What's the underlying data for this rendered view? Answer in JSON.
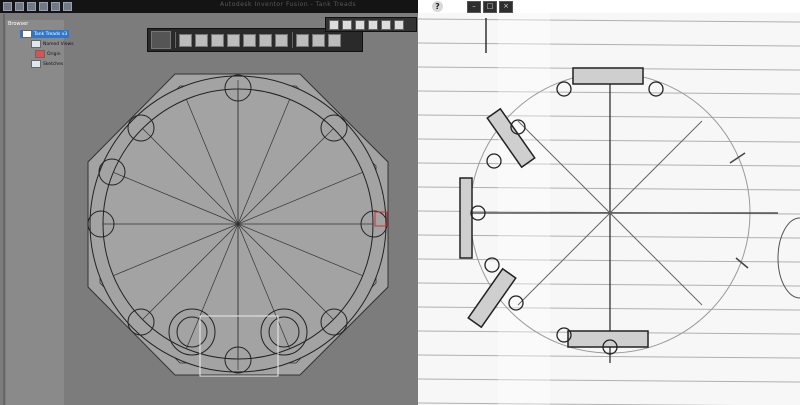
{
  "app": {
    "title": "Autodesk Inventor Fusion - Tank Treads"
  },
  "browser": {
    "header": "Browser",
    "root": "Tank Treads v3",
    "items": [
      {
        "label": "Named Views"
      },
      {
        "label": "Origin"
      },
      {
        "label": "Sketches"
      }
    ]
  },
  "help_glyph": "?",
  "window": {
    "minimize": "–",
    "maximize": "□",
    "close": "×"
  },
  "ribbon": {
    "tools": [
      "view-cube-icon",
      "line-tool-icon",
      "box-icon",
      "extrude-icon",
      "revolve-icon",
      "fillet-icon",
      "shell-icon",
      "color-icon",
      "appearance-icon",
      "material-icon",
      "render-icon"
    ]
  },
  "nav": {
    "tools": [
      "orbit-icon",
      "pan-icon",
      "zoom-icon",
      "look-icon",
      "fit-icon",
      "views-icon"
    ]
  },
  "colors": {
    "viewport": "#7c7c7c",
    "sketch_fill": "#a3a3a3",
    "selection": "#2f77c9",
    "paper": "#f7f7f7",
    "rule": "#b0b0b0"
  }
}
